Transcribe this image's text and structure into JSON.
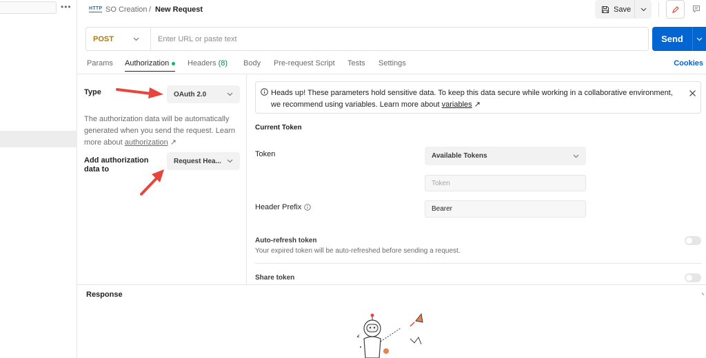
{
  "header": {
    "protocol_icon": "HTTP",
    "breadcrumb_parent": "SO Creation",
    "breadcrumb_separator": "/",
    "breadcrumb_current": "New Request",
    "save_label": "Save"
  },
  "request": {
    "method": "POST",
    "url_value": "",
    "url_placeholder": "Enter URL or paste text",
    "send_label": "Send"
  },
  "tabs": {
    "params": "Params",
    "authorization": "Authorization",
    "headers": "Headers",
    "headers_count": "(8)",
    "body": "Body",
    "prerequest": "Pre-request Script",
    "tests": "Tests",
    "settings": "Settings",
    "cookies": "Cookies"
  },
  "auth": {
    "type_label": "Type",
    "type_value": "OAuth 2.0",
    "desc_text": "The authorization data will be automatically generated when you send the request. Learn more about",
    "desc_link": "authorization",
    "add_label": "Add authorization data to",
    "add_value": "Request Hea..."
  },
  "alert": {
    "text": "Heads up! These parameters hold sensitive data. To keep this data secure while working in a collaborative environment, we recommend using variables. Learn more about",
    "link": "variables"
  },
  "token": {
    "section_title": "Current Token",
    "token_label": "Token",
    "available_tokens": "Available Tokens",
    "token_value": "",
    "token_placeholder": "Token",
    "prefix_label": "Header Prefix",
    "prefix_value": "Bearer",
    "refresh_title": "Auto-refresh token",
    "refresh_desc": "Your expired token will be auto-refreshed before sending a request.",
    "refresh_enabled": false,
    "share_title": "Share token",
    "share_enabled": false
  },
  "response": {
    "label": "Response"
  },
  "colors": {
    "send": "#0265d2",
    "method": "#ad7a03",
    "active_dot": "#0cbb52",
    "arrow": "#e8453c"
  }
}
